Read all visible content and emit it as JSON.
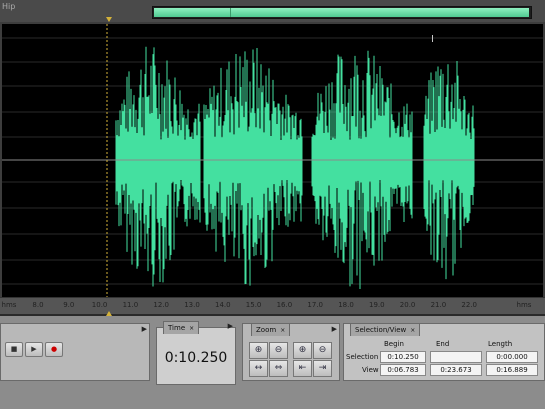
{
  "overview": {
    "label": "Hip"
  },
  "ruler": {
    "units_left": "hms",
    "units_right": "hms",
    "ticks": [
      "8.0",
      "9.0",
      "10.0",
      "11.0",
      "12.0",
      "13.0",
      "14.0",
      "15.0",
      "16.0",
      "17.0",
      "18.0",
      "19.0",
      "20.0",
      "21.0",
      "22.0"
    ]
  },
  "transport": {
    "stop": "■",
    "play": "▶",
    "record": "●"
  },
  "time_panel": {
    "tab": "Time",
    "close": "×",
    "value": "0:10.250"
  },
  "zoom_panel": {
    "tab": "Zoom",
    "close": "×"
  },
  "selection_panel": {
    "tab": "Selection/View",
    "close": "×",
    "headers": {
      "begin": "Begin",
      "end": "End",
      "length": "Length"
    },
    "selection": {
      "label": "Selection",
      "begin": "0:10.250",
      "end": "",
      "length": "0:00.000"
    },
    "view": {
      "label": "View",
      "begin": "0:06.783",
      "end": "0:23.673",
      "length": "0:16.889"
    }
  },
  "colors": {
    "waveform": "#44e0a0",
    "background": "#000000",
    "grid": "#2a2a2a",
    "marker": "#d4b23a"
  }
}
